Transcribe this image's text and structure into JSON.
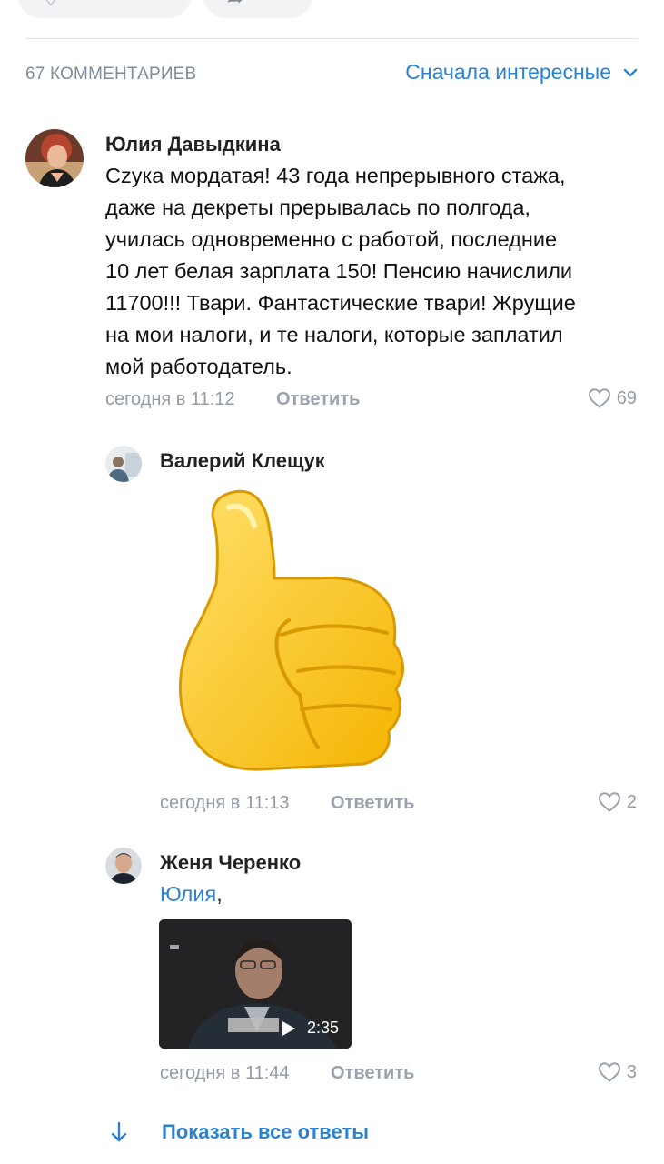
{
  "comments_header": {
    "count_label": "67 КОММЕНТАРИЕВ",
    "sort_label": "Сначала интересные"
  },
  "comments": [
    {
      "author": "Юлия Давыдкина",
      "text_lines": [
        "Сzука мордатая! 43 года непрерывного стажа,",
        "даже на декреты прерывалась по полгода,",
        "училась одновременно с работой, последние",
        "10 лет белая зарплата 150! Пенсию начислили",
        "11700!!! Твари. Фантастические твари! Жрущие",
        "на мои налоги, и те  налоги, которые заплатил",
        "мой работодатель."
      ],
      "time": "сегодня в 11:12",
      "reply_label": "Ответить",
      "likes": "69"
    }
  ],
  "replies": [
    {
      "author": "Валерий Клещук",
      "time": "сегодня в 11:13",
      "reply_label": "Ответить",
      "likes": "2"
    },
    {
      "author": "Женя Черенко",
      "mention": "Юлия",
      "mention_suffix": ",",
      "video_duration": "2:35",
      "time": "сегодня в 11:44",
      "reply_label": "Ответить",
      "likes": "3"
    }
  ],
  "show_all_label": "Показать все ответы",
  "colors": {
    "accent": "#2a83d1",
    "secondary_text": "#939ba6",
    "divider": "#dce1e6",
    "sticker_yellow": "#ffc93d"
  },
  "icons": [
    "heart-outline-icon",
    "chevron-down-icon",
    "arrow-down-icon",
    "play-icon",
    "thumbs-up-sticker"
  ]
}
